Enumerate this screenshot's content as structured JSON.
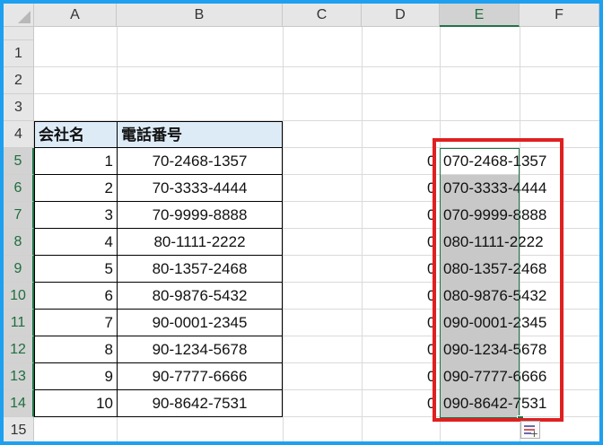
{
  "columns": [
    "A",
    "B",
    "C",
    "D",
    "E",
    "F"
  ],
  "rows": [
    "1",
    "2",
    "3",
    "4",
    "5",
    "6",
    "7",
    "8",
    "9",
    "10",
    "11",
    "12",
    "13",
    "14",
    "15"
  ],
  "table": {
    "headers": [
      "会社名",
      "電話番号"
    ],
    "rows": [
      {
        "id": "1",
        "phone": "70-2468-1357"
      },
      {
        "id": "2",
        "phone": "70-3333-4444"
      },
      {
        "id": "3",
        "phone": "70-9999-8888"
      },
      {
        "id": "4",
        "phone": "80-1111-2222"
      },
      {
        "id": "5",
        "phone": "80-1357-2468"
      },
      {
        "id": "6",
        "phone": "80-9876-5432"
      },
      {
        "id": "7",
        "phone": "90-0001-2345"
      },
      {
        "id": "8",
        "phone": "90-1234-5678"
      },
      {
        "id": "9",
        "phone": "90-7777-6666"
      },
      {
        "id": "10",
        "phone": "90-8642-7531"
      }
    ]
  },
  "col_d_values": [
    "0",
    "0",
    "0",
    "0",
    "0",
    "0",
    "0",
    "0",
    "0",
    "0"
  ],
  "col_e_values": [
    "070-2468-1357",
    "070-3333-4444",
    "070-9999-8888",
    "080-1111-2222",
    "080-1357-2468",
    "080-9876-5432",
    "090-0001-2345",
    "090-1234-5678",
    "090-7777-6666",
    "090-8642-7531"
  ],
  "selection": {
    "range": "E5:E14",
    "active_cell": "E5"
  },
  "icons": {
    "select_all": "select-all-triangle-icon",
    "paste_options": "paste-options-icon"
  },
  "colors": {
    "header_fill": "#ddebf7",
    "selection_green": "#217346",
    "highlight_red": "#e02020",
    "frame_blue": "#1ea0f0"
  }
}
